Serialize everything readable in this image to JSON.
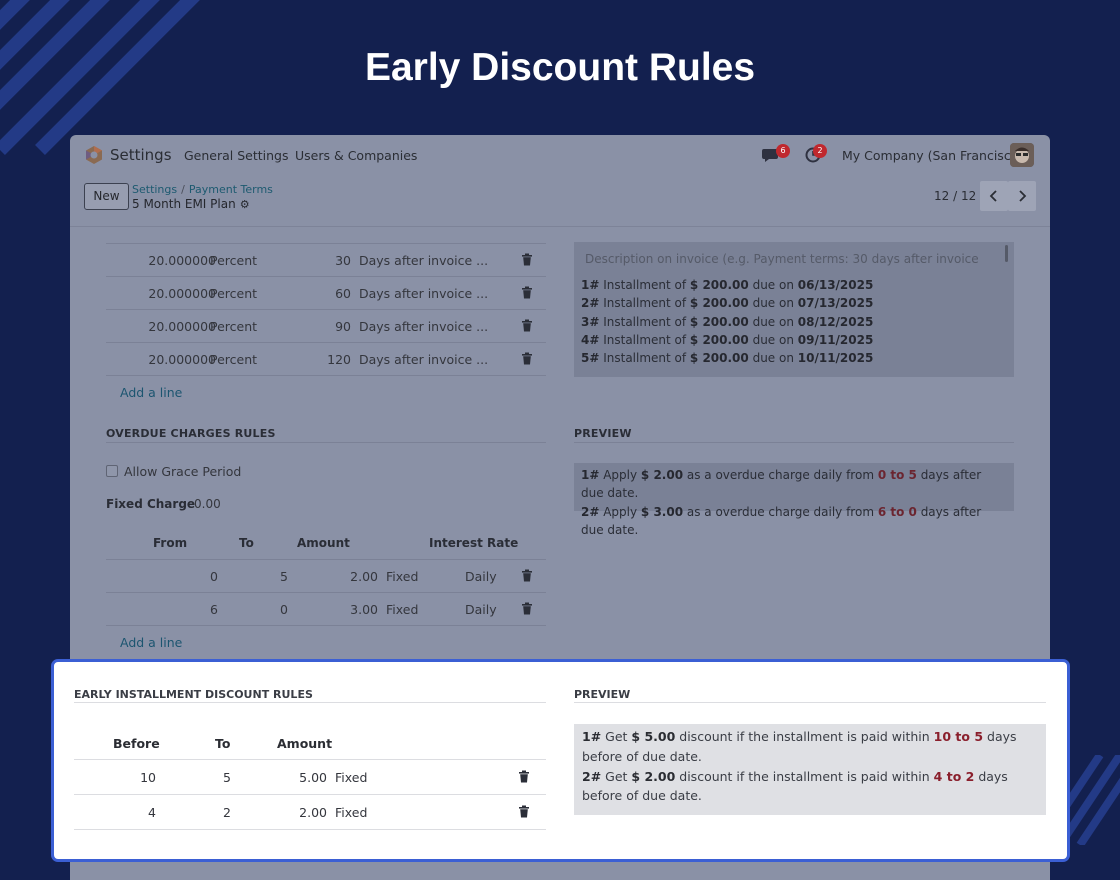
{
  "page_title": "Early Discount Rules",
  "topbar": {
    "app_name": "Settings",
    "nav": [
      "General Settings",
      "Users & Companies"
    ],
    "messages_count": "6",
    "activities_count": "2",
    "company": "My Company (San Francisco)"
  },
  "control": {
    "new_label": "New",
    "breadcrumb": [
      "Settings",
      "Payment Terms"
    ],
    "record_name": "5 Month EMI Plan",
    "pager": "12 / 12"
  },
  "installments": {
    "rows": [
      {
        "value": "20.000000",
        "type": "Percent",
        "days": "30",
        "option": "Days after invoice ..."
      },
      {
        "value": "20.000000",
        "type": "Percent",
        "days": "60",
        "option": "Days after invoice ..."
      },
      {
        "value": "20.000000",
        "type": "Percent",
        "days": "90",
        "option": "Days after invoice ..."
      },
      {
        "value": "20.000000",
        "type": "Percent",
        "days": "120",
        "option": "Days after invoice ..."
      }
    ],
    "add_line": "Add a line"
  },
  "description": {
    "placeholder": "Description on invoice (e.g. Payment terms: 30 days after invoice",
    "lines": [
      {
        "num": "1#",
        "text": " Installment of ",
        "amount": "$ 200.00",
        "due": " due on ",
        "date": "06/13/2025"
      },
      {
        "num": "2#",
        "text": " Installment of ",
        "amount": "$ 200.00",
        "due": " due on ",
        "date": "07/13/2025"
      },
      {
        "num": "3#",
        "text": " Installment of ",
        "amount": "$ 200.00",
        "due": " due on ",
        "date": "08/12/2025"
      },
      {
        "num": "4#",
        "text": " Installment of ",
        "amount": "$ 200.00",
        "due": " due on ",
        "date": "09/11/2025"
      },
      {
        "num": "5#",
        "text": " Installment of ",
        "amount": "$ 200.00",
        "due": " due on ",
        "date": "10/11/2025"
      }
    ]
  },
  "overdue": {
    "title": "OVERDUE CHARGES RULES",
    "grace_label": "Allow Grace Period",
    "fixed_charge_label": "Fixed Charge",
    "fixed_charge_value": "0.00",
    "headers": [
      "From",
      "To",
      "Amount",
      "Interest Rate"
    ],
    "rows": [
      {
        "from": "0",
        "to": "5",
        "amount": "2.00",
        "type": "Fixed",
        "rate": "Daily"
      },
      {
        "from": "6",
        "to": "0",
        "amount": "3.00",
        "type": "Fixed",
        "rate": "Daily"
      }
    ],
    "add_line": "Add a line"
  },
  "overdue_preview": {
    "title": "PREVIEW",
    "lines": [
      {
        "num": "1#",
        "a": " Apply ",
        "amount": "$ 2.00",
        "b": " as a overdue charge daily from ",
        "range": "0 to 5",
        "c": " days after due date."
      },
      {
        "num": "2#",
        "a": " Apply ",
        "amount": "$ 3.00",
        "b": " as a overdue charge daily from ",
        "range": "6 to 0",
        "c": " days after due date."
      }
    ]
  },
  "early": {
    "title": "EARLY INSTALLMENT DISCOUNT RULES",
    "headers": [
      "Before",
      "To",
      "Amount"
    ],
    "rows": [
      {
        "before": "10",
        "to": "5",
        "amount": "5.00",
        "type": "Fixed"
      },
      {
        "before": "4",
        "to": "2",
        "amount": "2.00",
        "type": "Fixed"
      }
    ]
  },
  "early_preview": {
    "title": "PREVIEW",
    "lines": [
      {
        "num": "1#",
        "a": " Get ",
        "amount": "$ 5.00",
        "b": " discount if the installment is paid within ",
        "range": "10 to 5",
        "c": " days before of due date."
      },
      {
        "num": "2#",
        "a": " Get ",
        "amount": "$ 2.00",
        "b": " discount if the installment is paid within ",
        "range": "4 to 2",
        "c": " days before of due date."
      }
    ]
  }
}
